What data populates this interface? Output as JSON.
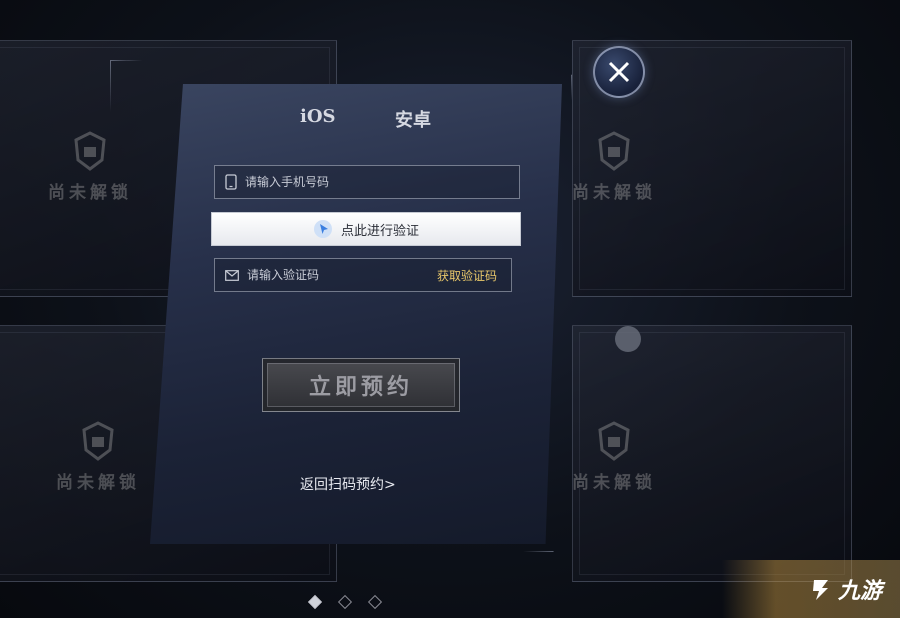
{
  "tabs": [
    {
      "label": "iOS"
    },
    {
      "label": "安卓"
    }
  ],
  "form": {
    "phone_placeholder": "请输入手机号码",
    "verify_label": "点此进行验证",
    "code_placeholder": "请输入验证码",
    "get_code_label": "获取验证码",
    "reserve_label": "立即预约",
    "return_label": "返回扫码预约>"
  },
  "locked_cards": [
    {
      "label": "尚未解锁"
    },
    {
      "label": "尚未解锁"
    },
    {
      "label": "尚未解锁"
    },
    {
      "label": "尚未解锁"
    }
  ],
  "carousel": {
    "count": 3,
    "active_index": 0
  },
  "watermark": {
    "text": "九游"
  },
  "colors": {
    "accent_gold": "#e8c76a",
    "panel_dark": "#1b2236"
  }
}
